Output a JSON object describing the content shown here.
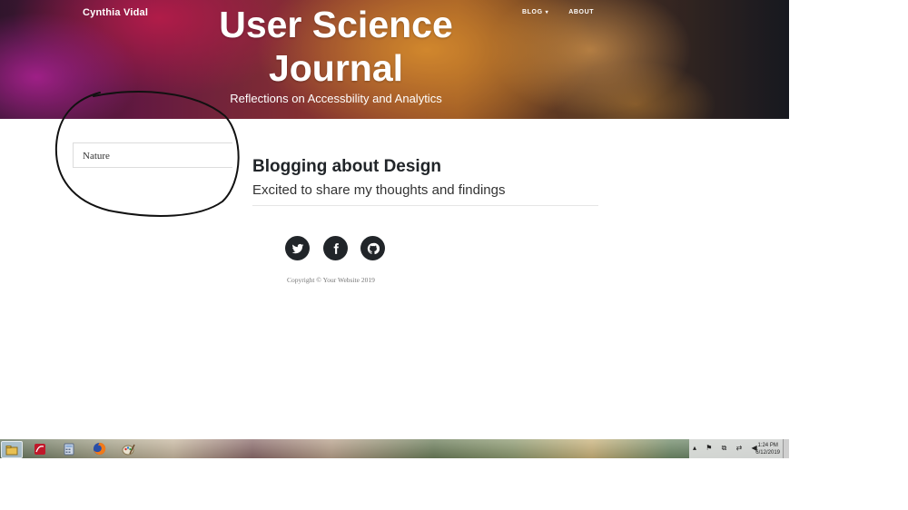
{
  "header": {
    "brand": "Cynthia Vidal",
    "nav": [
      {
        "label": "BLOG",
        "has_dropdown": true
      },
      {
        "label": "ABOUT",
        "has_dropdown": false
      }
    ],
    "title": "User Science Journal",
    "subtitle": "Reflections on Accessbility and Analytics"
  },
  "sidebar": {
    "tag_label": "Nature"
  },
  "post": {
    "title": "Blogging about Design",
    "subtitle": "Excited to share my thoughts and findings"
  },
  "footer": {
    "socials": [
      "twitter-icon",
      "facebook-icon",
      "github-icon"
    ],
    "copyright": "Copyright © Your Website 2019"
  },
  "taskbar": {
    "pinned": [
      "file-explorer-icon",
      "pdf-reader-icon",
      "calculator-icon",
      "firefox-icon",
      "paint-icon"
    ],
    "clock_time": "1:24 PM",
    "clock_date": "6/12/2019"
  },
  "colors": {
    "text_dark": "#212529",
    "social_bg": "#212529",
    "annotation_ink": "#111111"
  }
}
